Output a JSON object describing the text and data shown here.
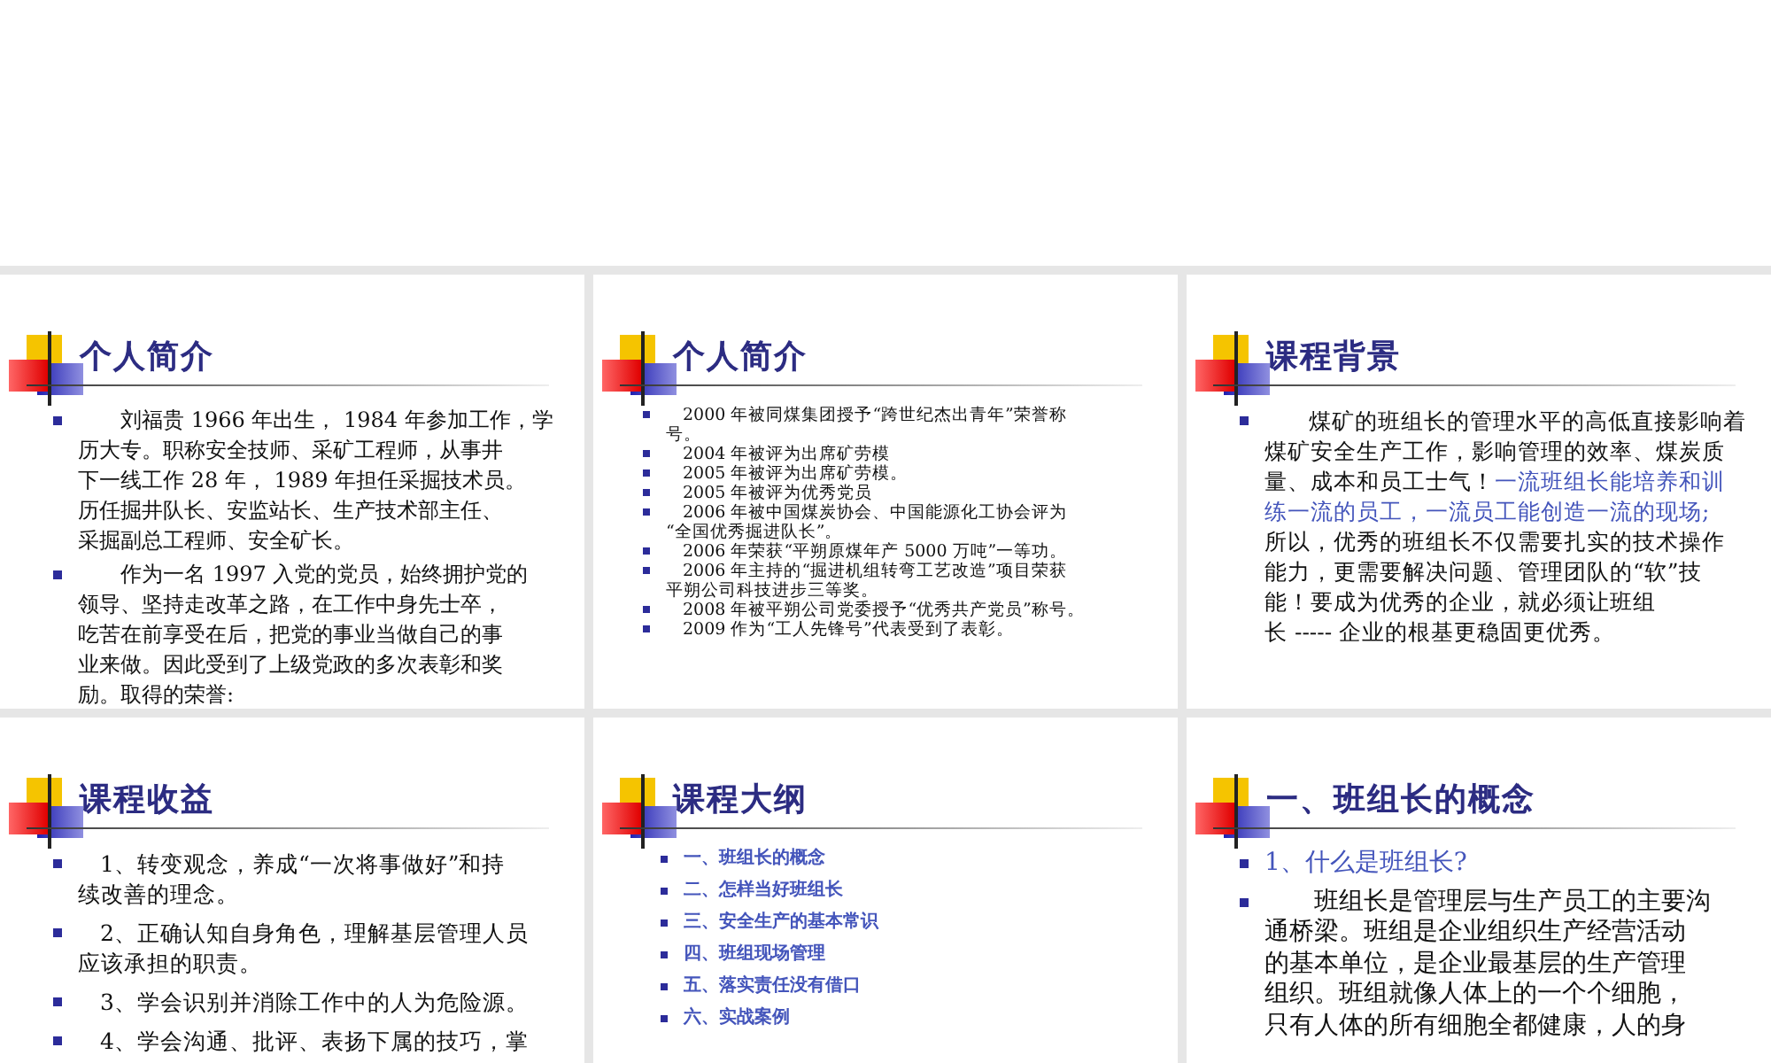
{
  "slides": [
    {
      "title": "个人简介",
      "bullets": [
        {
          "kind": "body",
          "lines": [
            "刘福贵 1966 年出生， 1984 年参加工作，学",
            "历大专。职称安全技师、采矿工程师，从事井",
            "下一线工作 28 年， 1989 年担任采掘技术员。",
            "历任掘井队长、安监站长、生产技术部主任、",
            "采掘副总工程师、安全矿长。"
          ]
        },
        {
          "kind": "body",
          "lines": [
            "作为一名 1997 入党的党员，始终拥护党的",
            "领导、坚持走改革之路，在工作中身先士卒，",
            "吃苦在前享受在后，把党的事业当做自己的事",
            "业来做。因此受到了上级党政的多次表彰和奖",
            "励。取得的荣誉:"
          ]
        }
      ]
    },
    {
      "title": "个人简介",
      "bullets": [
        {
          "kind": "body",
          "lines": [
            "2000 年被同煤集团授予“跨世纪杰出青年”荣誉称",
            "号。"
          ]
        },
        {
          "kind": "body",
          "lines": [
            "2004 年被评为出席矿劳模"
          ]
        },
        {
          "kind": "body",
          "lines": [
            "2005 年被评为出席矿劳模。"
          ]
        },
        {
          "kind": "body",
          "lines": [
            "2005 年被评为优秀党员"
          ]
        },
        {
          "kind": "body",
          "lines": [
            "2006 年被中国煤炭协会、中国能源化工协会评为",
            "“全国优秀掘进队长”。"
          ]
        },
        {
          "kind": "body",
          "lines": [
            "2006 年荣获“平朔原煤年产 5000 万吨”一等功。"
          ]
        },
        {
          "kind": "body",
          "lines": [
            "2006 年主持的“掘进机组转弯工艺改造”项目荣获",
            "平朔公司科技进步三等奖。"
          ]
        },
        {
          "kind": "body",
          "lines": [
            "2008 年被平朔公司党委授予“优秀共产党员”称号。"
          ]
        },
        {
          "kind": "body",
          "lines": [
            "2009 作为“工人先锋号”代表受到了表彰。"
          ]
        }
      ]
    },
    {
      "title": "课程背景",
      "bullets": [
        {
          "kind": "body",
          "lines": [
            "煤矿的班组长的管理水平的高低直接影响着",
            "煤矿安全生产工作，影响管理的效率、煤炭质",
            [
              {
                "text": "量、成本和员工士气！",
                "kind": "body"
              },
              {
                "text": "一流班组长能培养和训",
                "kind": "accent"
              }
            ],
            [
              {
                "text": "练一流的员工，一流员工能创造一流的现场;",
                "kind": "accent"
              }
            ],
            "所以，优秀的班组长不仅需要扎实的技术操作",
            "能力，更需要解决问题、管理团队的“软”技",
            "能！要成为优秀的企业，就必须让班组",
            "长 ----- 企业的根基更稳固更优秀。"
          ]
        }
      ]
    },
    {
      "title": "课程收益",
      "bullets": [
        {
          "kind": "body",
          "lines": [
            "1、转变观念，养成“一次将事做好”和持",
            "续改善的理念。"
          ]
        },
        {
          "kind": "body",
          "lines": [
            "2、正确认知自身角色，理解基层管理人员",
            "应该承担的职责。"
          ]
        },
        {
          "kind": "body",
          "lines": [
            "3、学会识别并消除工作中的人为危险源。"
          ]
        },
        {
          "kind": "body",
          "lines": [
            "4、学会沟通、批评、表扬下属的技巧，掌"
          ]
        }
      ]
    },
    {
      "title": "课程大纲",
      "bullets": [
        {
          "kind": "accent",
          "lines": [
            "一、班组长的概念"
          ]
        },
        {
          "kind": "accent",
          "lines": [
            "二、怎样当好班组长"
          ]
        },
        {
          "kind": "accent",
          "lines": [
            "三、安全生产的基本常识"
          ]
        },
        {
          "kind": "accent",
          "lines": [
            "四、班组现场管理"
          ]
        },
        {
          "kind": "accent",
          "lines": [
            "五、落实责任没有借口"
          ]
        },
        {
          "kind": "accent",
          "lines": [
            "六、实战案例"
          ]
        }
      ]
    },
    {
      "title": "一、班组长的概念",
      "bullets": [
        {
          "kind": "accent",
          "lines": [
            "1、什么是班组长?"
          ]
        },
        {
          "kind": "body",
          "lines": [
            "班组长是管理层与生产员工的主要沟",
            "通桥梁。班组是企业组织生产经营活动",
            "的基本单位，是企业最基层的生产管理",
            "组织。班组就像人体上的一个个细胞，",
            "只有人体的所有细胞全都健康，人的身"
          ]
        }
      ]
    }
  ]
}
